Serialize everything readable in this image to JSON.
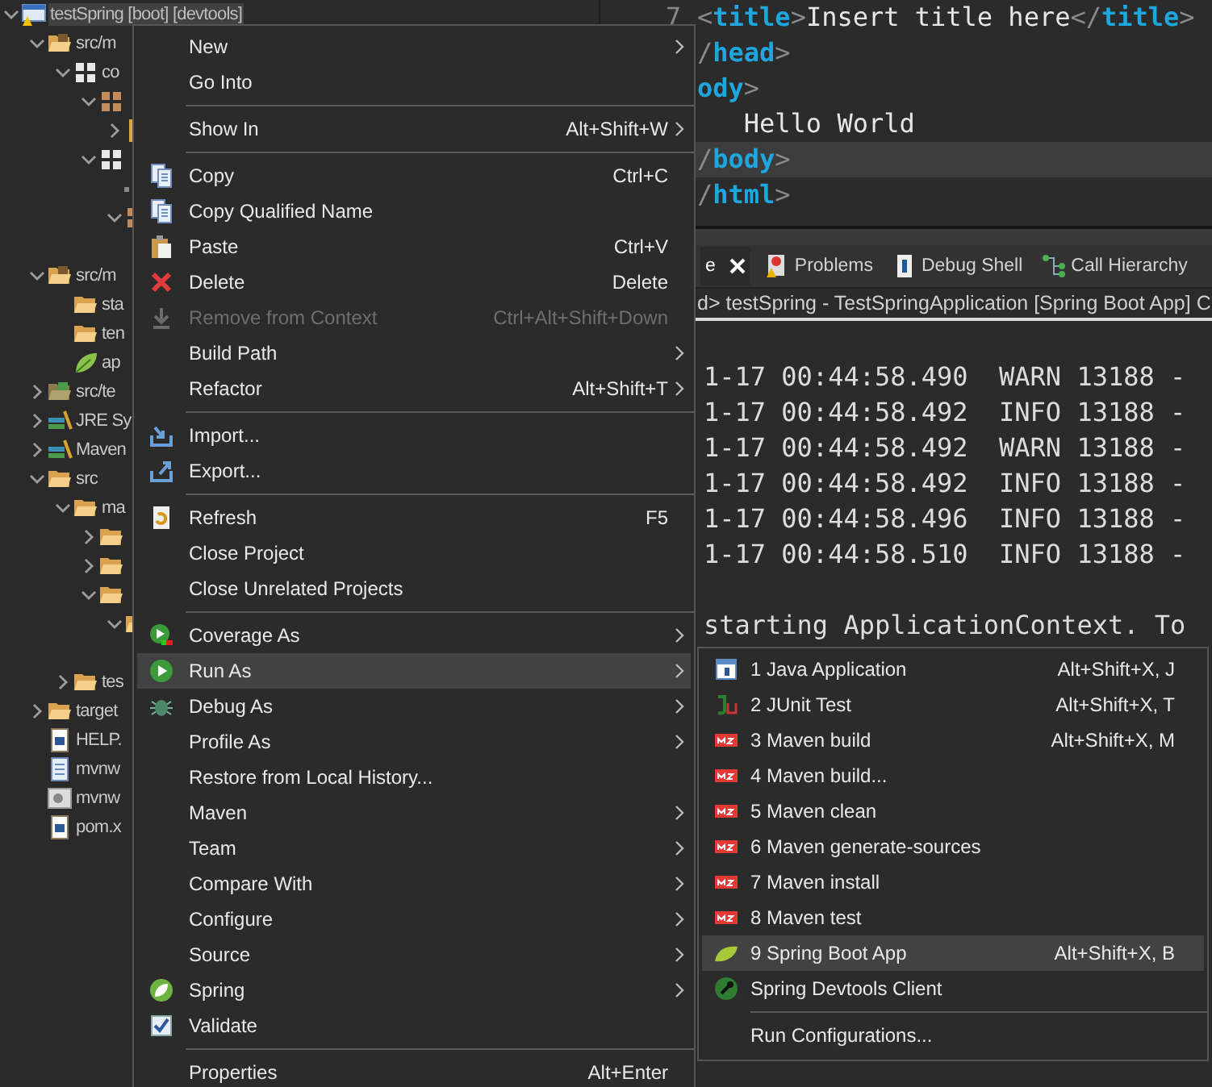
{
  "tree": [
    {
      "label": "testSpring [boot] [devtools]",
      "kind": "project",
      "expanded": true,
      "selected": true,
      "children": [
        {
          "label": "src/m",
          "kind": "source",
          "expanded": true,
          "selected": false,
          "children": [
            {
              "label": "co",
              "kind": "package",
              "expanded": true,
              "selected": false,
              "children": [
                {
                  "kind": "package-alt",
                  "expanded": true,
                  "selected": false,
                  "children": [
                    {
                      "kind": "file",
                      "expanded": false,
                      "selected": false
                    }
                  ]
                },
                {
                  "kind": "package",
                  "expanded": true,
                  "selected": false,
                  "children": [
                    {
                      "kind": "dot",
                      "selected": false
                    },
                    {
                      "kind": "package-alt",
                      "expanded": true,
                      "selected": false
                    }
                  ]
                }
              ]
            }
          ]
        },
        {
          "label": "src/m",
          "kind": "source",
          "expanded": true,
          "selected": false,
          "children": [
            {
              "label": "sta",
              "kind": "folder",
              "selected": false
            },
            {
              "label": "ten",
              "kind": "folder",
              "selected": false
            },
            {
              "label": "ap",
              "kind": "leaf",
              "selected": false
            }
          ]
        },
        {
          "label": "src/te",
          "kind": "source-test",
          "expanded": false,
          "selected": false
        },
        {
          "label": "JRE Sy",
          "kind": "library",
          "expanded": false,
          "selected": false
        },
        {
          "label": "Maven",
          "kind": "library",
          "expanded": false,
          "selected": false
        },
        {
          "label": "src",
          "kind": "folder",
          "expanded": true,
          "selected": false,
          "children": [
            {
              "label": "ma",
              "kind": "folder",
              "expanded": true,
              "selected": false,
              "children": [
                {
                  "kind": "folder",
                  "expanded": false,
                  "selected": false
                },
                {
                  "kind": "folder",
                  "expanded": false,
                  "selected": false
                },
                {
                  "kind": "folder",
                  "expanded": true,
                  "selected": false,
                  "children": [
                    {
                      "kind": "folder",
                      "expanded": true,
                      "selected": false
                    }
                  ]
                }
              ]
            },
            {
              "label": "tes",
              "kind": "folder",
              "expanded": false,
              "selected": false
            }
          ]
        },
        {
          "label": "target",
          "kind": "folder",
          "expanded": false,
          "selected": false
        },
        {
          "label": "HELP.",
          "kind": "word",
          "selected": false
        },
        {
          "label": "mvnw",
          "kind": "text",
          "selected": false
        },
        {
          "label": "mvnw",
          "kind": "cmd",
          "selected": false
        },
        {
          "label": "pom.x",
          "kind": "maven",
          "selected": false
        }
      ]
    }
  ],
  "editor": {
    "lines": [
      {
        "number": "7",
        "current": false,
        "tokens": [
          {
            "kind": "bracket",
            "text": "<"
          },
          {
            "kind": "tag",
            "text": "title"
          },
          {
            "kind": "bracket",
            "text": ">"
          },
          {
            "kind": "text",
            "text": "Insert title here"
          },
          {
            "kind": "bracket",
            "text": "</"
          },
          {
            "kind": "tag",
            "text": "title"
          },
          {
            "kind": "bracket",
            "text": ">"
          }
        ]
      },
      {
        "current": false,
        "tokens": [
          {
            "kind": "bracket",
            "text": "/"
          },
          {
            "kind": "tag",
            "text": "head"
          },
          {
            "kind": "bracket",
            "text": ">"
          }
        ]
      },
      {
        "current": false,
        "tokens": [
          {
            "kind": "tag",
            "text": "ody"
          },
          {
            "kind": "bracket",
            "text": ">"
          }
        ]
      },
      {
        "current": false,
        "tokens": [
          {
            "kind": "text",
            "text": "   Hello World"
          }
        ]
      },
      {
        "current": true,
        "tokens": [
          {
            "kind": "bracket",
            "text": "/"
          },
          {
            "kind": "tag",
            "text": "body"
          },
          {
            "kind": "bracket",
            "text": ">"
          }
        ]
      },
      {
        "current": false,
        "tokens": [
          {
            "kind": "bracket",
            "text": "/"
          },
          {
            "kind": "tag",
            "text": "html"
          },
          {
            "kind": "bracket",
            "text": ">"
          }
        ]
      }
    ]
  },
  "console": {
    "tabs": [
      {
        "label": "e",
        "selected": true,
        "closable": true
      },
      {
        "label": "Problems",
        "selected": false
      },
      {
        "label": "Debug Shell",
        "selected": false
      },
      {
        "label": "Call Hierarchy",
        "selected": false
      }
    ],
    "path": "d> testSpring - TestSpringApplication [Spring Boot App] C",
    "lines": [
      "1-17 00:44:58.490  WARN 13188 -",
      "1-17 00:44:58.492  INFO 13188 -",
      "1-17 00:44:58.492  WARN 13188 -",
      "1-17 00:44:58.492  INFO 13188 -",
      "1-17 00:44:58.496  INFO 13188 -",
      "1-17 00:44:58.510  INFO 13188 -"
    ],
    "message": "starting ApplicationContext. To"
  },
  "context_menu": [
    {
      "kind": "item",
      "label": "New",
      "submenu": true,
      "selected": false
    },
    {
      "kind": "item",
      "label": "Go Into",
      "selected": false
    },
    {
      "kind": "separator"
    },
    {
      "kind": "item",
      "label": "Show In",
      "shortcut": "Alt+Shift+W",
      "submenu": true,
      "selected": false
    },
    {
      "kind": "separator"
    },
    {
      "kind": "item",
      "label": "Copy",
      "shortcut": "Ctrl+C",
      "selected": false
    },
    {
      "kind": "item",
      "label": "Copy Qualified Name",
      "selected": false
    },
    {
      "kind": "item",
      "label": "Paste",
      "shortcut": "Ctrl+V",
      "selected": false
    },
    {
      "kind": "item",
      "label": "Delete",
      "shortcut": "Delete",
      "selected": false
    },
    {
      "kind": "item",
      "label": "Remove from Context",
      "shortcut": "Ctrl+Alt+Shift+Down",
      "disabled": true,
      "selected": false
    },
    {
      "kind": "item",
      "label": "Build Path",
      "submenu": true,
      "selected": false
    },
    {
      "kind": "item",
      "label": "Refactor",
      "shortcut": "Alt+Shift+T",
      "submenu": true,
      "selected": false
    },
    {
      "kind": "separator"
    },
    {
      "kind": "item",
      "label": "Import...",
      "selected": false
    },
    {
      "kind": "item",
      "label": "Export...",
      "selected": false
    },
    {
      "kind": "separator"
    },
    {
      "kind": "item",
      "label": "Refresh",
      "shortcut": "F5",
      "selected": false
    },
    {
      "kind": "item",
      "label": "Close Project",
      "selected": false
    },
    {
      "kind": "item",
      "label": "Close Unrelated Projects",
      "selected": false
    },
    {
      "kind": "separator"
    },
    {
      "kind": "item",
      "label": "Coverage As",
      "submenu": true,
      "selected": false
    },
    {
      "kind": "item",
      "label": "Run As",
      "submenu": true,
      "selected": true
    },
    {
      "kind": "item",
      "label": "Debug As",
      "submenu": true,
      "selected": false
    },
    {
      "kind": "item",
      "label": "Profile As",
      "submenu": true,
      "selected": false
    },
    {
      "kind": "item",
      "label": "Restore from Local History...",
      "selected": false
    },
    {
      "kind": "item",
      "label": "Maven",
      "submenu": true,
      "selected": false
    },
    {
      "kind": "item",
      "label": "Team",
      "submenu": true,
      "selected": false
    },
    {
      "kind": "item",
      "label": "Compare With",
      "submenu": true,
      "selected": false
    },
    {
      "kind": "item",
      "label": "Configure",
      "submenu": true,
      "selected": false
    },
    {
      "kind": "item",
      "label": "Source",
      "submenu": true,
      "selected": false
    },
    {
      "kind": "item",
      "label": "Spring",
      "submenu": true,
      "selected": false
    },
    {
      "kind": "item",
      "label": "Validate",
      "selected": false
    },
    {
      "kind": "separator"
    },
    {
      "kind": "item",
      "label": "Properties",
      "shortcut": "Alt+Enter",
      "selected": false
    }
  ],
  "run_as_menu": [
    {
      "kind": "item",
      "label": "1 Java Application",
      "shortcut": "Alt+Shift+X, J",
      "selected": false
    },
    {
      "kind": "item",
      "label": "2 JUnit Test",
      "shortcut": "Alt+Shift+X, T",
      "selected": false
    },
    {
      "kind": "item",
      "label": "3 Maven build",
      "shortcut": "Alt+Shift+X, M",
      "selected": false
    },
    {
      "kind": "item",
      "label": "4 Maven build...",
      "selected": false
    },
    {
      "kind": "item",
      "label": "5 Maven clean",
      "selected": false
    },
    {
      "kind": "item",
      "label": "6 Maven generate-sources",
      "selected": false
    },
    {
      "kind": "item",
      "label": "7 Maven install",
      "selected": false
    },
    {
      "kind": "item",
      "label": "8 Maven test",
      "selected": false
    },
    {
      "kind": "item",
      "label": "9 Spring Boot App",
      "shortcut": "Alt+Shift+X, B",
      "selected": true
    },
    {
      "kind": "item",
      "label": "Spring Devtools Client",
      "selected": false
    },
    {
      "kind": "separator"
    },
    {
      "kind": "item",
      "label": "Run Configurations...",
      "selected": false
    }
  ]
}
